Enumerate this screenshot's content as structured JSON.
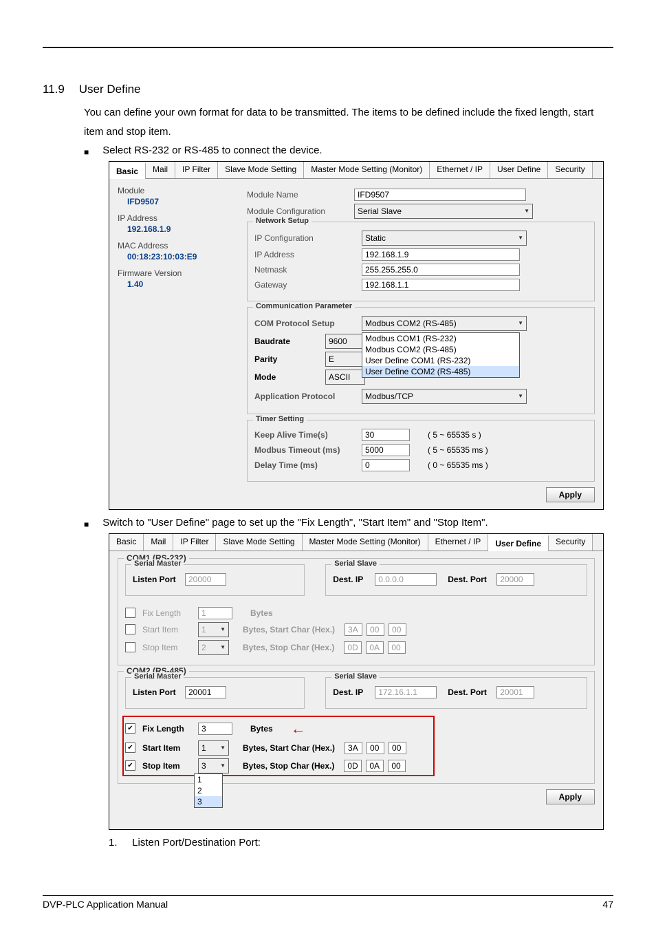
{
  "section": {
    "number": "11.9",
    "title": "User Define"
  },
  "para1": "You can define your own format for data to be transmitted. The items to be defined include the fixed length, start item and stop item.",
  "bullet1": "Select RS-232 or RS-485 to connect the device.",
  "bullet2": "Switch to \"User Define\" page to set up the \"Fix Length\", \"Start Item\" and \"Stop Item\".",
  "note1": {
    "n": "1.",
    "t": "Listen Port/Destination Port:"
  },
  "footer": {
    "left": "DVP-PLC Application Manual",
    "right": "47"
  },
  "tabs": {
    "basic": "Basic",
    "mail": "Mail",
    "ipfilter": "IP Filter",
    "slave": "Slave Mode Setting",
    "master": "Master Mode Setting (Monitor)",
    "eth": "Ethernet / IP",
    "user": "User Define",
    "sec": "Security"
  },
  "shot1": {
    "left": {
      "module_lbl": "Module",
      "module_val": "IFD9507",
      "ip_lbl": "IP Address",
      "ip_val": "192.168.1.9",
      "mac_lbl": "MAC Address",
      "mac_val": "00:18:23:10:03:E9",
      "fw_lbl": "Firmware Version",
      "fw_val": "1.40"
    },
    "top": {
      "name_lbl": "Module Name",
      "name_val": "IFD9507",
      "cfg_lbl": "Module Configuration",
      "cfg_val": "Serial Slave"
    },
    "net": {
      "title": "Network Setup",
      "ipc_lbl": "IP Configuration",
      "ipc_val": "Static",
      "ip_lbl": "IP Address",
      "ip_val": "192.168.1.9",
      "mask_lbl": "Netmask",
      "mask_val": "255.255.255.0",
      "gw_lbl": "Gateway",
      "gw_val": "192.168.1.1"
    },
    "comm": {
      "title": "Communication Parameter",
      "com_lbl": "COM Protocol Setup",
      "com_val": "Modbus COM2 (RS-485)",
      "baud_lbl": "Baudrate",
      "baud_val": "9600",
      "par_lbl": "Parity",
      "par_val": "E",
      "mode_lbl": "Mode",
      "mode_val": "ASCII",
      "app_lbl": "Application Protocol",
      "app_val": "Modbus/TCP",
      "options": {
        "o1": "Modbus COM1 (RS-232)",
        "o2": "Modbus COM2 (RS-485)",
        "o3": "User Define COM1 (RS-232)",
        "o4": "User Define COM2 (RS-485)"
      }
    },
    "timer": {
      "title": "Timer Setting",
      "ka_lbl": "Keep Alive Time(s)",
      "ka_val": "30",
      "ka_rng": "( 5 ~ 65535 s )",
      "to_lbl": "Modbus Timeout (ms)",
      "to_val": "5000",
      "to_rng": "( 5 ~ 65535 ms )",
      "dl_lbl": "Delay Time (ms)",
      "dl_val": "0",
      "dl_rng": "( 0 ~ 65535 ms )"
    },
    "apply": "Apply"
  },
  "shot2": {
    "com1": {
      "title": "COM1 (RS-232)",
      "sm": "Serial Master",
      "ss": "Serial Slave",
      "lp_lbl": "Listen Port",
      "lp_val": "20000",
      "di_lbl": "Dest. IP",
      "di_val": "0.0.0.0",
      "dp_lbl": "Dest. Port",
      "dp_val": "20000",
      "fix_lbl": "Fix Length",
      "fix_byte": "1",
      "bytes_lbl": "Bytes",
      "start_lbl": "Start Item",
      "start_n": "1",
      "start_lbl2": "Bytes, Start Char (Hex.)",
      "sc1": "3A",
      "sc2": "00",
      "sc3": "00",
      "stop_lbl": "Stop Item",
      "stop_n": "2",
      "stop_lbl2": "Bytes, Stop Char (Hex.)",
      "st1": "0D",
      "st2": "0A",
      "st3": "00"
    },
    "com2": {
      "title": "COM2 (RS-485)",
      "sm": "Serial Master",
      "ss": "Serial Slave",
      "lp_lbl": "Listen Port",
      "lp_val": "20001",
      "di_lbl": "Dest. IP",
      "di_val": "172.16.1.1",
      "dp_lbl": "Dest. Port",
      "dp_val": "20001",
      "fix_lbl": "Fix Length",
      "fix_byte": "3",
      "bytes_lbl": "Bytes",
      "start_lbl": "Start Item",
      "start_n": "1",
      "start_lbl2": "Bytes, Start Char (Hex.)",
      "sc1": "3A",
      "sc2": "00",
      "sc3": "00",
      "stop_lbl": "Stop Item",
      "stop_n": "3",
      "stop_lbl2": "Bytes, Stop Char (Hex.)",
      "st1": "0D",
      "st2": "0A",
      "st3": "00",
      "dropdown": {
        "a": "1",
        "b": "2",
        "c": "3"
      }
    },
    "apply": "Apply"
  }
}
